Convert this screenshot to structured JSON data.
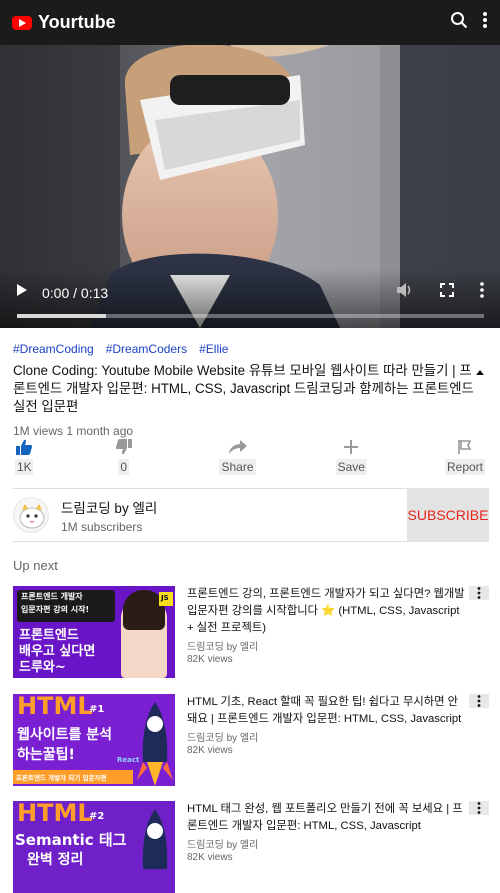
{
  "header": {
    "title": "Yourtube",
    "icons": [
      "search-icon",
      "more-vertical-icon"
    ]
  },
  "player": {
    "time": "0:00 / 0:13",
    "progress": 0.19,
    "icons": [
      "play-icon",
      "mute-icon",
      "fullscreen-icon",
      "more-vertical-icon"
    ]
  },
  "video": {
    "hashtags": [
      "#DreamCoding",
      "#DreamCoders",
      "#Ellie"
    ],
    "title": "Clone Coding: Youtube Mobile Website 유튜브 모바일 웹사이트 따라 만들기 | 프론트엔드 개발자 입문편: HTML, CSS, Javascript 드림코딩과 함께하는 프론트엔드 실전 입문편",
    "meta": "1M views 1 month ago"
  },
  "actions": [
    {
      "label": "1K",
      "icon": "thumbs-up-icon"
    },
    {
      "label": "0",
      "icon": "thumbs-down-icon"
    },
    {
      "label": "Share",
      "icon": "share-icon"
    },
    {
      "label": "Save",
      "icon": "plus-icon"
    },
    {
      "label": "Report",
      "icon": "flag-icon"
    }
  ],
  "channel": {
    "name": "드림코딩 by 엘리",
    "subscribers": "1M subscribers",
    "subscribe_label": "SUBSCRIBE"
  },
  "upnext": {
    "heading": "Up next"
  },
  "items": [
    {
      "title": "프론트엔드 강의, 프론트엔드 개발자가 되고 싶다면? 웹개발 입문자편 강의를 시작합니다 ⭐ (HTML, CSS, Javascript + 실전 프로젝트)",
      "channel": "드림코딩 by 엘리",
      "views": "82K views",
      "thumb_text": [
        "프론트엔드 개발자",
        "입문자편 강의 시작!",
        "프론트엔드",
        "배우고 싶다면",
        "드루와~",
        "JS"
      ]
    },
    {
      "title": "HTML 기초, React 할때 꼭 필요한 팁! 쉽다고 무시하면 안돼요 | 프론트엔드 개발자 입문편: HTML, CSS, Javascript",
      "channel": "드림코딩 by 엘리",
      "views": "82K views",
      "thumb_text": [
        "HTML",
        "#1",
        "웹사이트를 분석",
        "하는꿀팁!",
        "React",
        "프론트엔드 개발자 되기 입문자편"
      ]
    },
    {
      "title": "HTML 태그 완성, 웹 포트폴리오 만들기 전에 꼭 보세요 | 프론트엔드 개발자 입문편: HTML, CSS, Javascript",
      "channel": "드림코딩 by 엘리",
      "views": "82K views",
      "thumb_text": [
        "HTML",
        "#2",
        "Semantic 태그",
        "완벽 정리"
      ]
    }
  ]
}
